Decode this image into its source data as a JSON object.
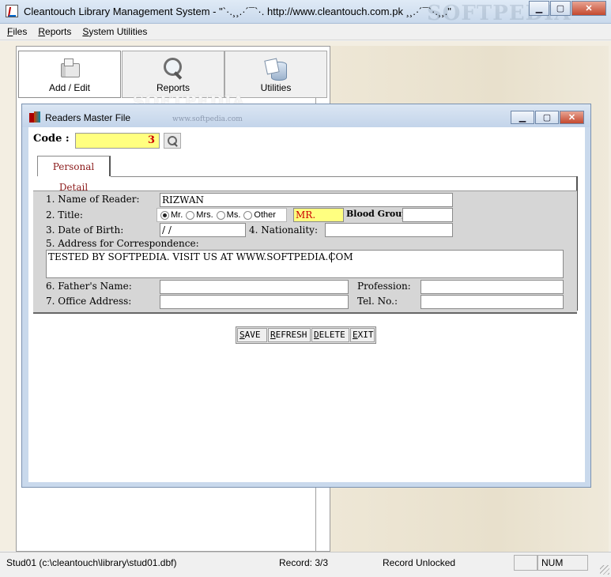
{
  "window": {
    "title": "Cleantouch Library Management System  -  \"`·.¸¸.·´¯`·. http://www.cleantouch.com.pk ¸¸.·´¯`·.¸¸.\"",
    "watermark": "SOFTPEDIA"
  },
  "menu": {
    "items": [
      {
        "first": "F",
        "rest": "iles"
      },
      {
        "first": "R",
        "rest": "eports"
      },
      {
        "first": "S",
        "rest": "ystem Utilities"
      }
    ]
  },
  "toolbar": {
    "buttons": [
      {
        "label": "Add / Edit",
        "icon": "keys-icon"
      },
      {
        "label": "Reports",
        "icon": "magnifier-icon"
      },
      {
        "label": "Utilities",
        "icon": "database-icon"
      }
    ],
    "watermark": "SOFTPEDIA"
  },
  "child": {
    "title": "Readers Master File",
    "watermark": "www.softpedia.com",
    "code_label": "Code :",
    "code_value": "3",
    "tab": "Personal Detail",
    "labels": {
      "name": "1. Name of Reader:",
      "title": "2. Title:",
      "dob": "3. Date of Birth:",
      "nationality": "4. Nationality:",
      "address": "5. Address for Correspondence:",
      "father": "6. Father's Name:",
      "office": "7. Office Address:",
      "blood": "Blood Group",
      "profession": "Profession:",
      "tel": "Tel. No.:"
    },
    "values": {
      "name": "RIZWAN",
      "title_text": "MR.",
      "dob": " /  /",
      "address": "TESTED BY SOFTPEDIA. VISIT US AT WWW.SOFTPEDIA.COM",
      "blood": "",
      "nationality": "",
      "father": "",
      "office": "",
      "profession": "",
      "tel": ""
    },
    "radios": [
      "Mr.",
      "Mrs.",
      "Ms.",
      "Other"
    ],
    "selected_radio": "Mr.",
    "commands": [
      {
        "first": "S",
        "rest": "AVE"
      },
      {
        "first": "R",
        "rest": "EFRESH"
      },
      {
        "first": "D",
        "rest": "ELETE"
      },
      {
        "first": "E",
        "rest": "XIT"
      }
    ]
  },
  "status": {
    "file": "Stud01 (c:\\cleantouch\\library\\stud01.dbf)",
    "record": "Record: 3/3",
    "lock": "Record Unlocked",
    "num": "NUM"
  },
  "colors": {
    "highlight_yellow": "#ffff80",
    "code_red": "#cc0000",
    "tab_text": "#8b1a1a"
  }
}
